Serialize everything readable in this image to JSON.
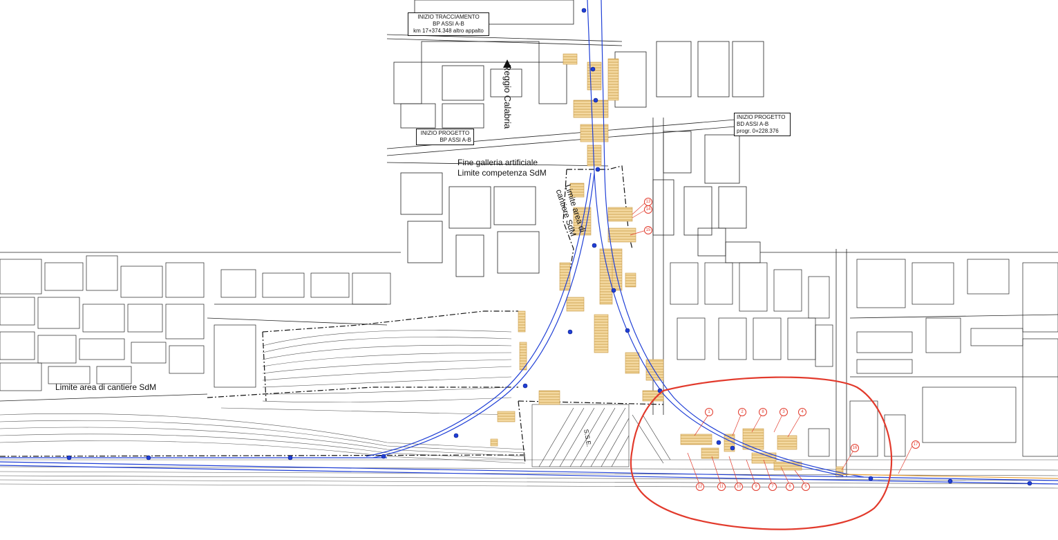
{
  "labels": {
    "reggio": "Reggio Calabria",
    "fine_galleria": "Fine galleria artificiale",
    "limite_competenza": "Limite competenza SdM",
    "limite_area_vertical": [
      "Limite area di",
      "cantiere SdM"
    ],
    "limite_area_bottom": "Limite area di cantiere SdM",
    "sse": "S.S.E."
  },
  "boxes": {
    "inizio_tracciamento": [
      "INIZIO TRACCIAMENTO",
      "BP ASSI A-B",
      "km 17+374.348 altro appalto"
    ],
    "inizio_progetto_bp": [
      "INIZIO PROGETTO",
      "BP ASSI A-B"
    ],
    "inizio_progetto_bd": [
      "INIZIO PROGETTO",
      "BD ASSI A-B",
      "progr. 0+228.376"
    ]
  },
  "callouts": [
    "1",
    "2",
    "3",
    "4",
    "5",
    "6",
    "7",
    "8",
    "9",
    "10",
    "11",
    "12",
    "13",
    "14",
    "15",
    "16",
    "17"
  ],
  "colors": {
    "building_outline": "#1a1a1a",
    "hatch": "#e9c27a",
    "alignment": "#1f3fd6",
    "annotation": "#e23a2c"
  }
}
